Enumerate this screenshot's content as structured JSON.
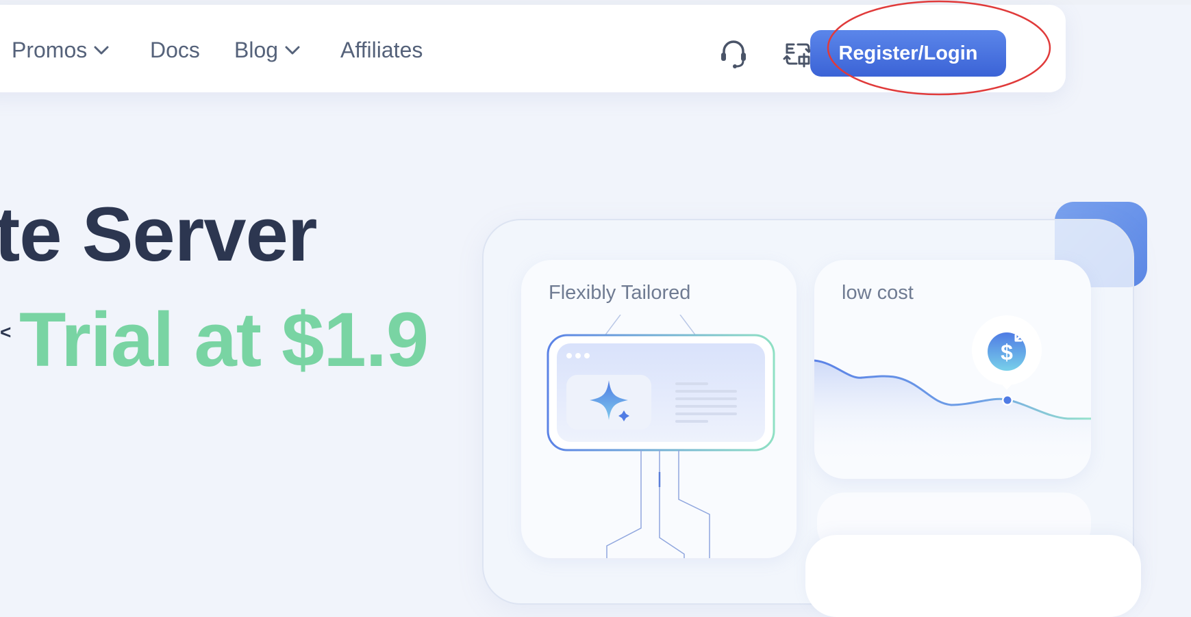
{
  "nav": {
    "items": [
      {
        "label": "Promos",
        "has_dropdown": true
      },
      {
        "label": "Docs",
        "has_dropdown": false
      },
      {
        "label": "Blog",
        "has_dropdown": true
      },
      {
        "label": "Affiliates",
        "has_dropdown": false
      }
    ],
    "icons": [
      "headset-icon",
      "language-switch-icon"
    ],
    "register_label": "Register/Login"
  },
  "hero": {
    "headline": "te Server",
    "subline": "Trial at $1.9"
  },
  "features": {
    "card1_title": "Flexibly Tailored",
    "card2_title": "low cost"
  },
  "colors": {
    "accent": "#4a72e0",
    "green": "#79d4a3",
    "headline": "#2c3650",
    "annotation": "#e03a3a"
  }
}
